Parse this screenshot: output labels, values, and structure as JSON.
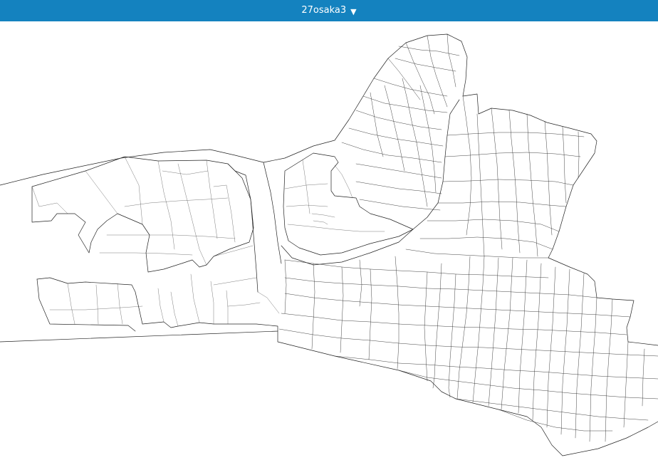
{
  "header": {
    "layer_name": "27osaka3",
    "dropdown_icon": "triangle-down-icon",
    "background_color": "#1482bf",
    "text_color": "#ffffff"
  },
  "map": {
    "style": "outline",
    "line_color": "#222222",
    "background_color": "#ffffff"
  }
}
